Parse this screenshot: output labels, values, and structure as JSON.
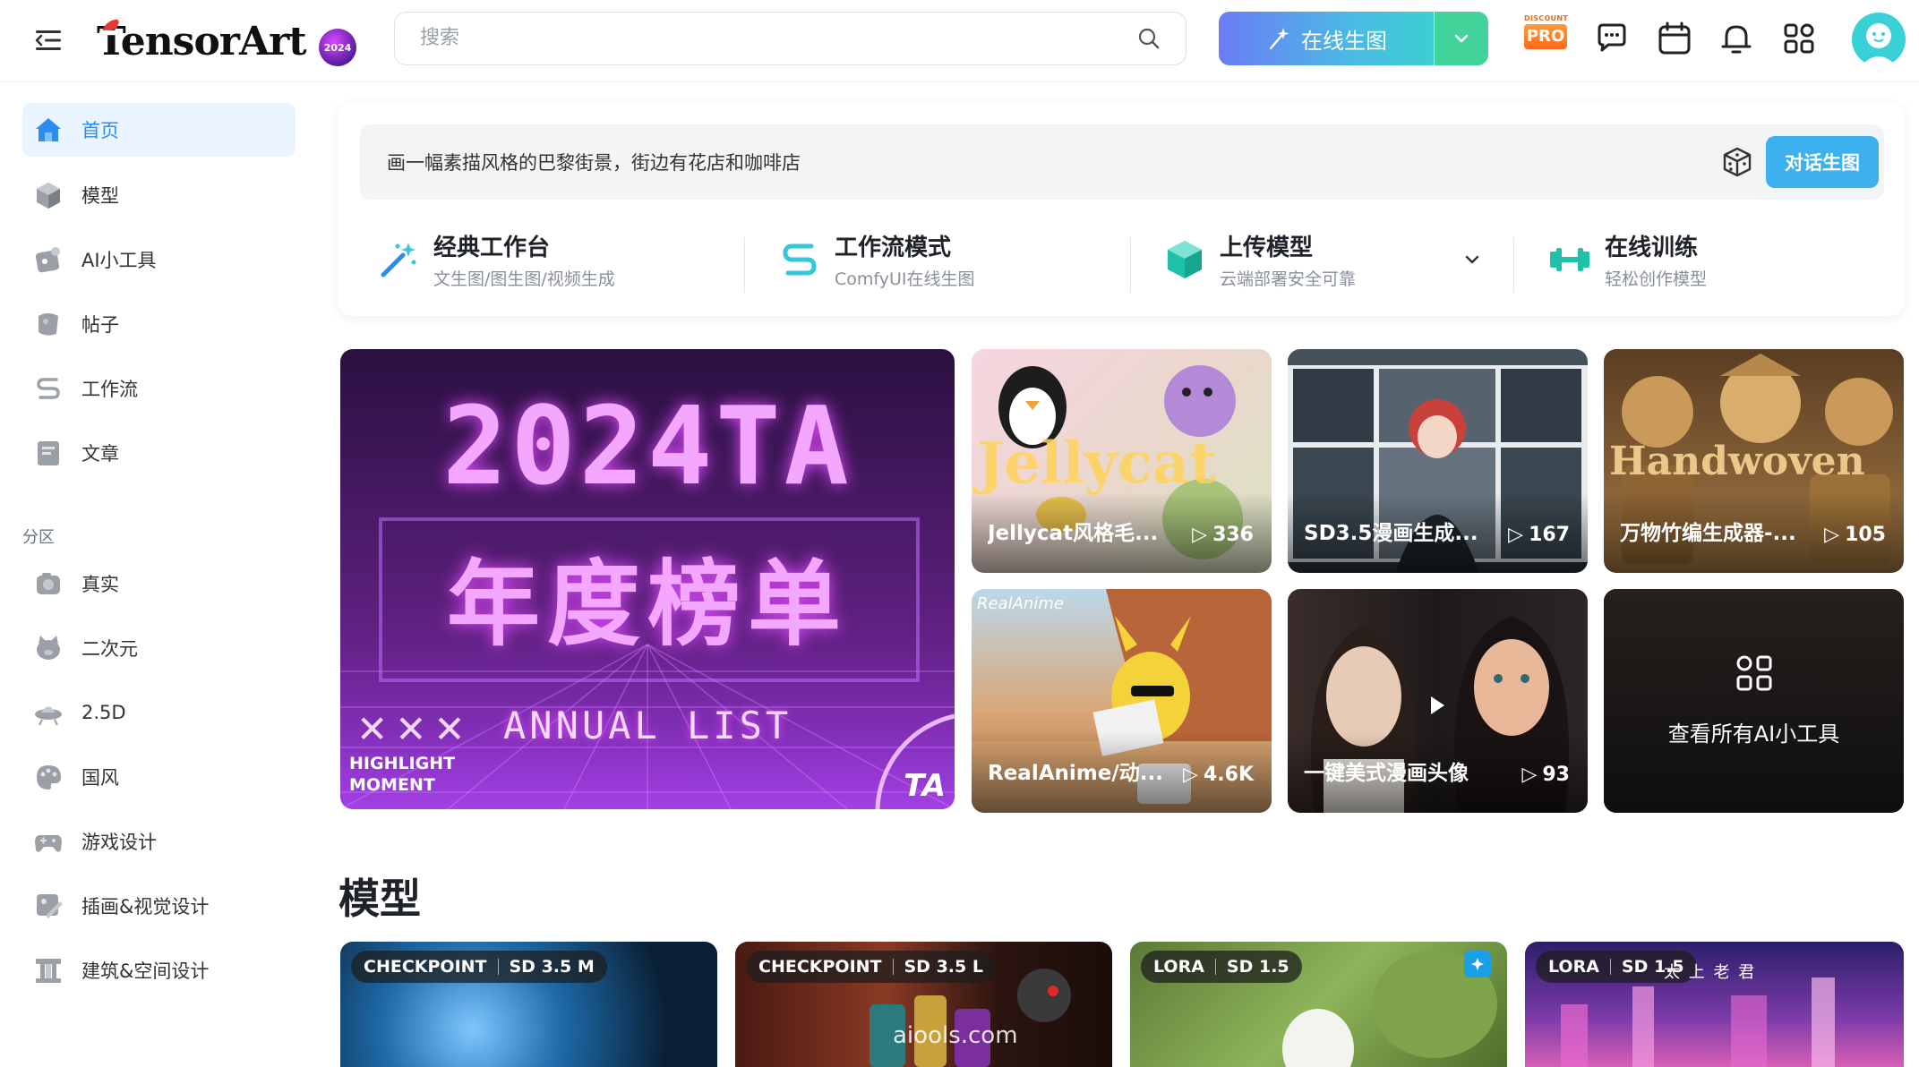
{
  "header": {
    "logo_text": "TensorArt",
    "badge_2024": "2024",
    "search_placeholder": "搜索",
    "generate_label": "在线生图",
    "pro_top": "DISCOUNT",
    "pro_main": "PRO"
  },
  "sidebar": {
    "items": [
      {
        "label": "首页",
        "icon": "home-icon"
      },
      {
        "label": "模型",
        "icon": "cube-icon"
      },
      {
        "label": "AI小工具",
        "icon": "ai-tool-icon"
      },
      {
        "label": "帖子",
        "icon": "post-icon"
      },
      {
        "label": "工作流",
        "icon": "workflow-icon"
      },
      {
        "label": "文章",
        "icon": "article-icon"
      }
    ],
    "section_title": "分区",
    "sections": [
      {
        "label": "真实",
        "icon": "camera-icon"
      },
      {
        "label": "二次元",
        "icon": "anime-icon"
      },
      {
        "label": "2.5D",
        "icon": "ufo-icon"
      },
      {
        "label": "国风",
        "icon": "palette-icon"
      },
      {
        "label": "游戏设计",
        "icon": "gamepad-icon"
      },
      {
        "label": "插画&视觉设计",
        "icon": "illustration-icon"
      },
      {
        "label": "建筑&空间设计",
        "icon": "pillar-icon"
      }
    ]
  },
  "prompt": {
    "text": "画一幅素描风格的巴黎街景，街边有花店和咖啡店",
    "button": "对话生图"
  },
  "modes": [
    {
      "title": "经典工作台",
      "subtitle": "文生图/图生图/视频生成",
      "icon": "magic-wand-icon"
    },
    {
      "title": "工作流模式",
      "subtitle": "ComfyUI在线生图",
      "icon": "workflow-s-icon"
    },
    {
      "title": "上传模型",
      "subtitle": "云端部署安全可靠",
      "icon": "upload-cube-icon"
    },
    {
      "title": "在线训练",
      "subtitle": "轻松创作模型",
      "icon": "dumbbell-icon"
    }
  ],
  "banner": {
    "line1": "2024TA",
    "line2": "年度榜单",
    "line3": "ANNUAL LIST",
    "highlight_1": "HIGHLIGHT",
    "highlight_2": "MOMENT",
    "corner": "TA"
  },
  "cards": [
    {
      "title": "Jellycat风格毛...",
      "count": "336",
      "overlay": "Jellycat",
      "colors": [
        "#f4c9d8",
        "#e8dfd0"
      ]
    },
    {
      "title": "SD3.5漫画生成...",
      "count": "167",
      "overlay": "",
      "colors": [
        "#3a4550",
        "#7d8a95"
      ]
    },
    {
      "title": "万物竹编生成器-...",
      "count": "105",
      "overlay": "Handwoven",
      "colors": [
        "#6a4a28",
        "#c79a5a"
      ]
    },
    {
      "title": "RealAnime/动...",
      "count": "4.6K",
      "overlay": "RealAnime",
      "colors": [
        "#c7845a",
        "#9fc2d8"
      ]
    },
    {
      "title": "一键美式漫画头像",
      "count": "93",
      "overlay": "",
      "colors": [
        "#2b2226",
        "#8b7a72"
      ]
    },
    {
      "title": "查看所有AI小工具",
      "count": "",
      "overlay": "",
      "colors": [
        "#1a1a1a",
        "#3a3a3a"
      ]
    }
  ],
  "models_title": "模型",
  "models": [
    {
      "type": "CHECKPOINT",
      "base": "SD 3.5 M",
      "colors": [
        "#0b2a44",
        "#3d8fc8"
      ]
    },
    {
      "type": "CHECKPOINT",
      "base": "SD 3.5 L",
      "colors": [
        "#3b1a12",
        "#a0523a"
      ],
      "watermark": "aiools.com"
    },
    {
      "type": "LORA",
      "base": "SD 1.5",
      "colors": [
        "#4d6b2f",
        "#9bbf6a"
      ]
    },
    {
      "type": "LORA",
      "base": "SD 1.5",
      "colors": [
        "#2a1a5e",
        "#c24fb5"
      ],
      "overlay": "太 上 老 君"
    }
  ]
}
